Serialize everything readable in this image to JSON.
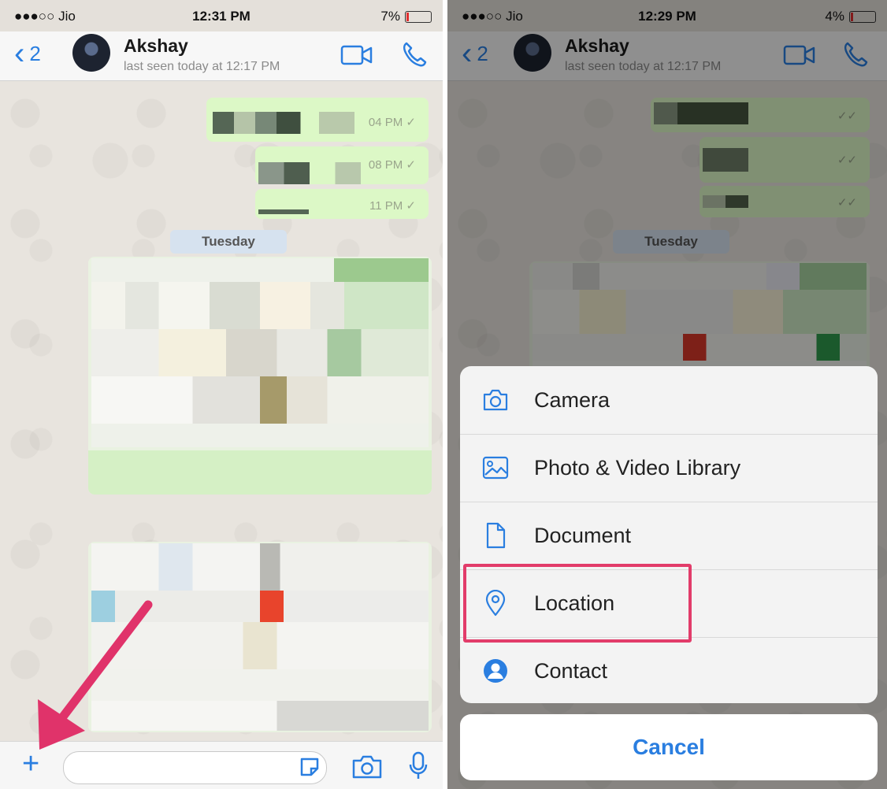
{
  "left": {
    "status": {
      "carrier": "●●●○○ Jio",
      "time": "12:31 PM",
      "battery": "7%"
    },
    "header": {
      "back_count": "2",
      "name": "Akshay",
      "last_seen": "last seen today at 12:17 PM"
    },
    "messages": [
      {
        "time": "04 PM ✓"
      },
      {
        "time": "08 PM ✓"
      },
      {
        "time": "11 PM ✓"
      }
    ],
    "day_label": "Tuesday",
    "input": {
      "add_icon": "plus-icon",
      "sticker_icon": "sticker-icon",
      "camera_icon": "camera-icon",
      "mic_icon": "microphone-icon"
    }
  },
  "right": {
    "status": {
      "carrier": "●●●○○ Jio",
      "time": "12:29 PM",
      "battery": "4%"
    },
    "header": {
      "back_count": "2",
      "name": "Akshay",
      "last_seen": "last seen today at 12:17 PM"
    },
    "messages": [
      {
        "time": "✓✓"
      },
      {
        "time": "✓✓"
      },
      {
        "time": "✓✓"
      }
    ],
    "day_label": "Tuesday",
    "sheet": {
      "options": [
        {
          "label": "Camera",
          "icon": "camera-icon"
        },
        {
          "label": "Photo & Video Library",
          "icon": "photo-library-icon"
        },
        {
          "label": "Document",
          "icon": "document-icon"
        },
        {
          "label": "Location",
          "icon": "location-pin-icon"
        },
        {
          "label": "Contact",
          "icon": "contact-icon"
        }
      ],
      "cancel": "Cancel",
      "highlighted": "Location"
    }
  },
  "colors": {
    "accent": "#2a7ee0",
    "bubble": "#dcf8c6",
    "highlight": "#e23c6a",
    "arrow": "#e0336a"
  }
}
